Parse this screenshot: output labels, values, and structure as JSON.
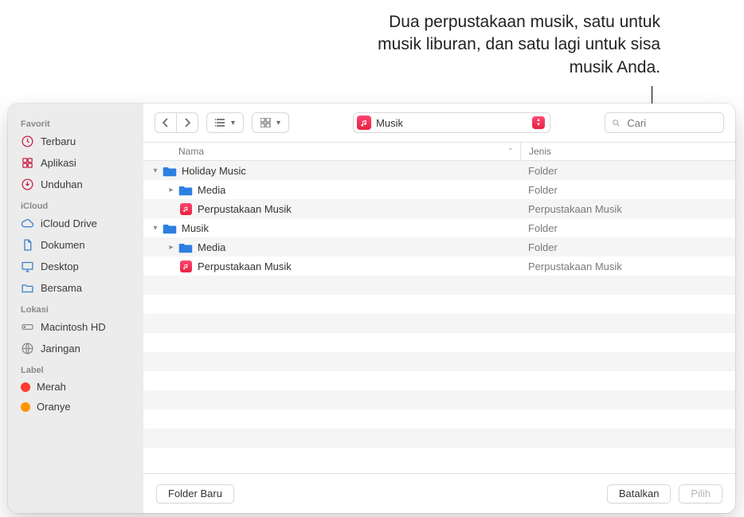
{
  "annotation": {
    "text": "Dua perpustakaan musik, satu untuk musik liburan, dan satu lagi untuk sisa musik Anda."
  },
  "sidebar": {
    "groups": [
      {
        "label": "Favorit",
        "items": [
          {
            "icon": "clock",
            "label": "Terbaru",
            "color": "red"
          },
          {
            "icon": "apps",
            "label": "Aplikasi",
            "color": "red"
          },
          {
            "icon": "download",
            "label": "Unduhan",
            "color": "red"
          }
        ]
      },
      {
        "label": "iCloud",
        "items": [
          {
            "icon": "cloud",
            "label": "iCloud Drive",
            "color": "blue"
          },
          {
            "icon": "doc",
            "label": "Dokumen",
            "color": "blue"
          },
          {
            "icon": "desktop",
            "label": "Desktop",
            "color": "blue"
          },
          {
            "icon": "shared",
            "label": "Bersama",
            "color": "blue"
          }
        ]
      },
      {
        "label": "Lokasi",
        "items": [
          {
            "icon": "disk",
            "label": "Macintosh HD",
            "color": "dim"
          },
          {
            "icon": "network",
            "label": "Jaringan",
            "color": "dim"
          }
        ]
      },
      {
        "label": "Label",
        "items": [
          {
            "icon": "tag-red",
            "label": "Merah"
          },
          {
            "icon": "tag-orange",
            "label": "Oranye"
          }
        ]
      }
    ]
  },
  "toolbar": {
    "path_label": "Musik"
  },
  "search": {
    "placeholder": "Cari"
  },
  "columns": {
    "name": "Nama",
    "kind": "Jenis"
  },
  "rows": [
    {
      "indent": 0,
      "disclosure": "open",
      "icon": "folder",
      "name": "Holiday Music",
      "kind": "Folder"
    },
    {
      "indent": 1,
      "disclosure": "closed",
      "icon": "folder",
      "name": "Media",
      "kind": "Folder"
    },
    {
      "indent": 1,
      "disclosure": "none",
      "icon": "library",
      "name": "Perpustakaan Musik",
      "kind": "Perpustakaan Musik"
    },
    {
      "indent": 0,
      "disclosure": "open",
      "icon": "folder",
      "name": "Musik",
      "kind": "Folder"
    },
    {
      "indent": 1,
      "disclosure": "closed",
      "icon": "folder",
      "name": "Media",
      "kind": "Folder"
    },
    {
      "indent": 1,
      "disclosure": "none",
      "icon": "library",
      "name": "Perpustakaan Musik",
      "kind": "Perpustakaan Musik"
    }
  ],
  "footer": {
    "new_folder": "Folder Baru",
    "cancel": "Batalkan",
    "choose": "Pilih"
  }
}
